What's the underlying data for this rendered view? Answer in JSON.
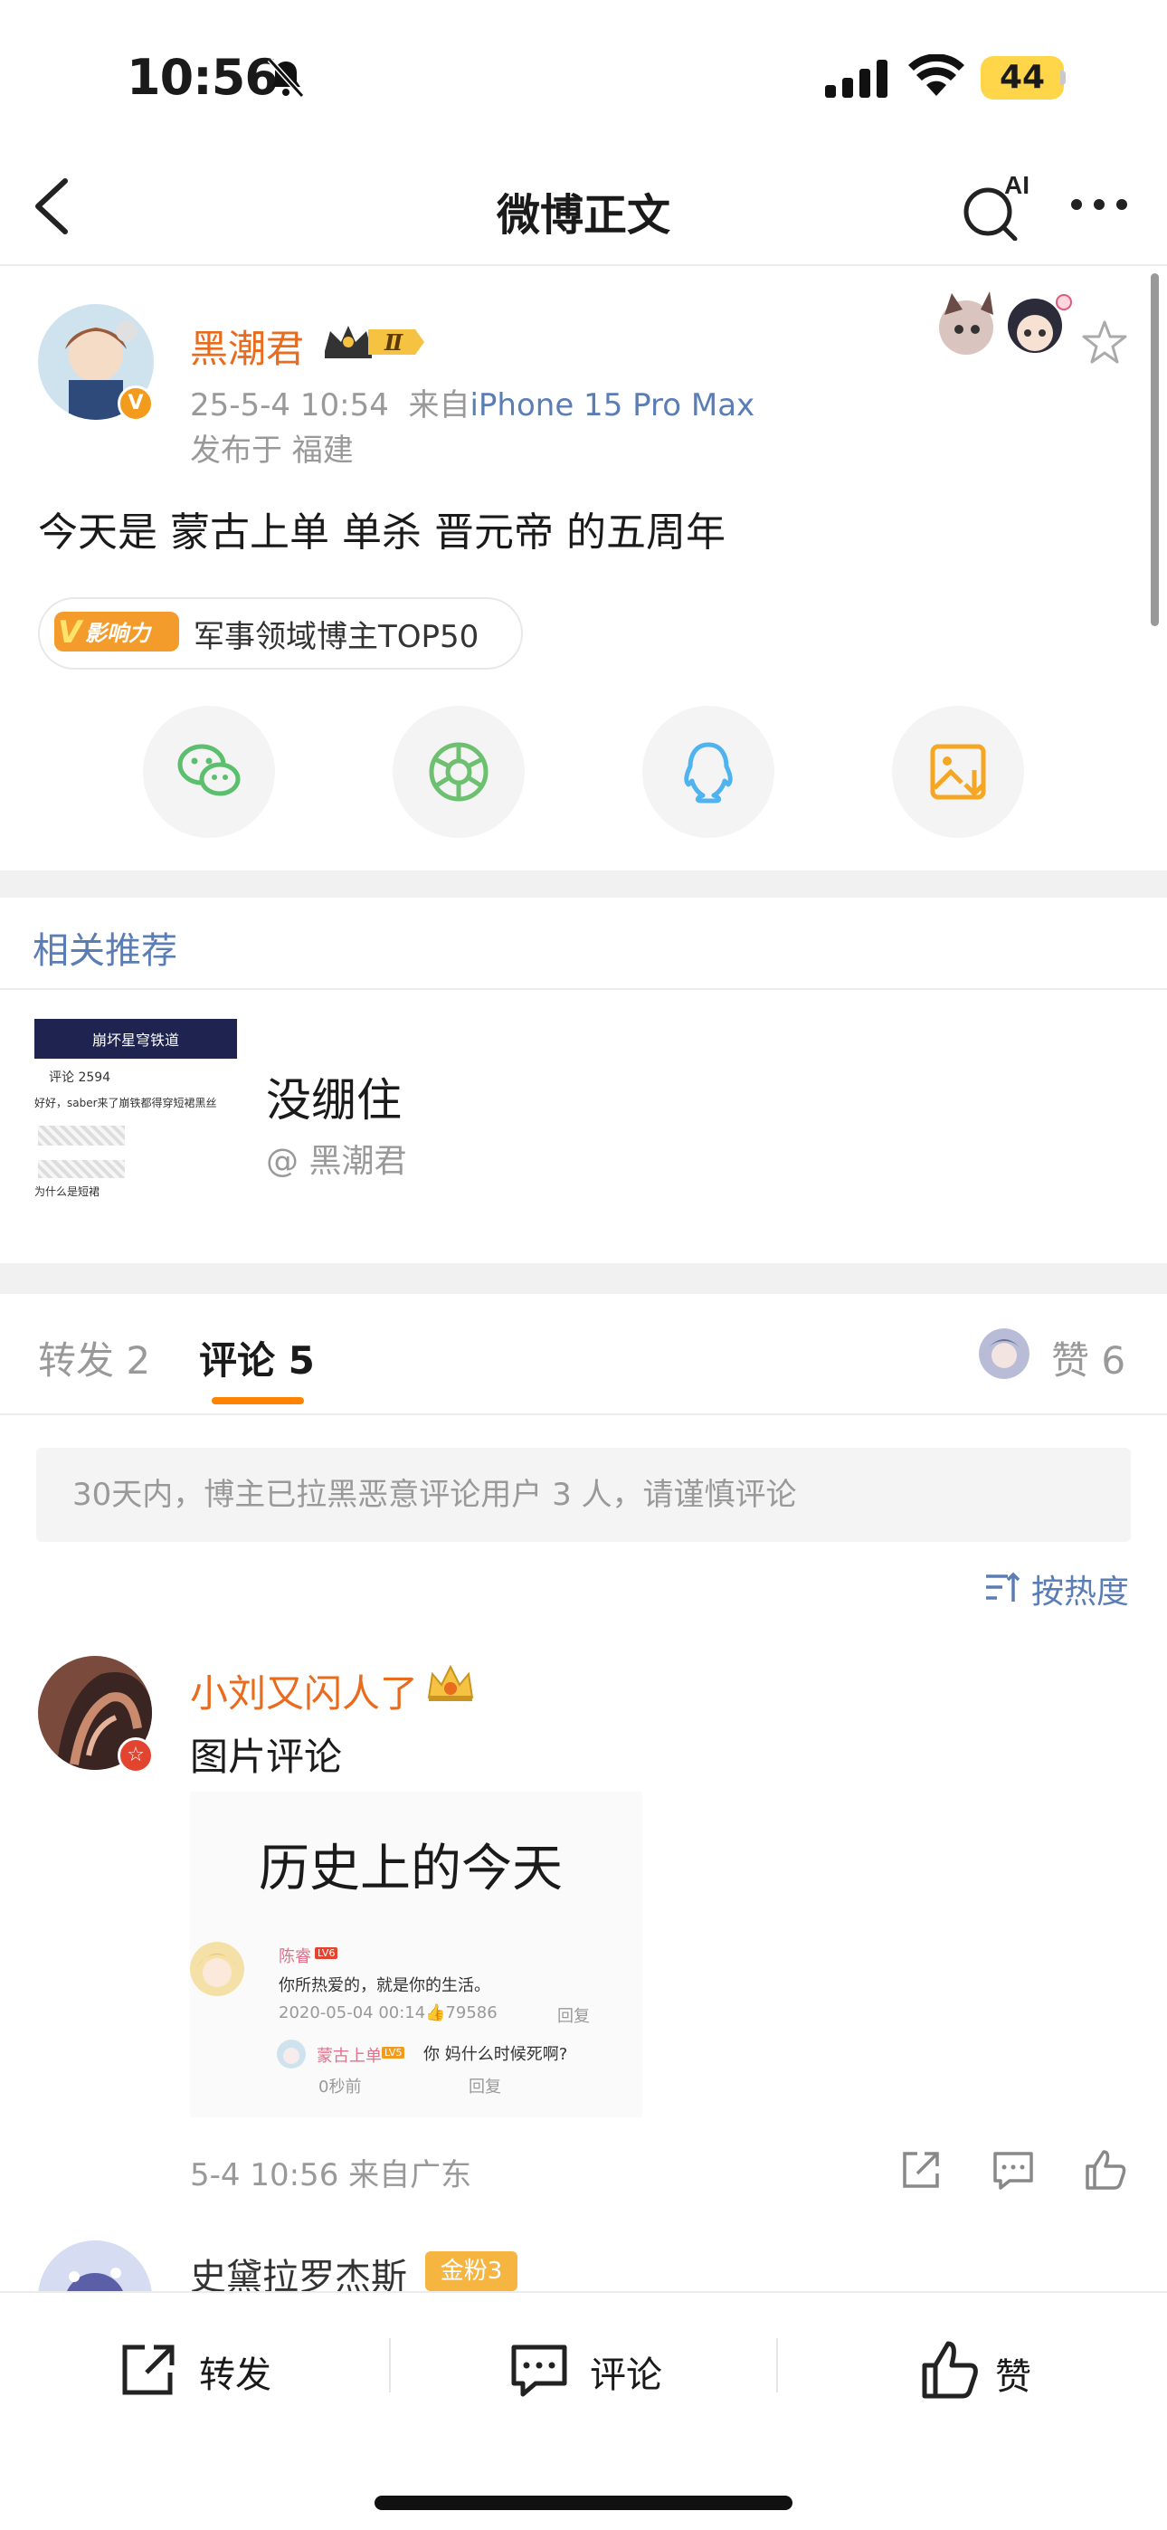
{
  "status_bar": {
    "time": "10:56",
    "battery": "44"
  },
  "nav": {
    "title": "微博正文",
    "ai_label": "AI"
  },
  "post": {
    "author": "黑潮君",
    "rank_badge": "Ⅱ",
    "verified_badge": "V",
    "date": "25-5-4 10:54",
    "source_prefix": "来自",
    "device": "iPhone 15 Pro Max",
    "location": "发布于 福建",
    "text": "今天是 蒙古上单 单杀 晋元帝 的五周年",
    "influence_tag": "V影响力",
    "influence_text": "军事领域博主TOP50"
  },
  "related": {
    "section_title": "相关推荐",
    "item_title": "没绷住",
    "item_author": "@ 黑潮君",
    "thumb": {
      "header": "崩坏星穹铁道",
      "comments": "评论 2594",
      "line1": "好好，saber来了崩铁都得穿短裙黑丝",
      "line2": "为什么是短裙"
    }
  },
  "tabs": {
    "repost": "转发 2",
    "comments": "评论 5",
    "likes": "赞 6"
  },
  "notice": "30天内，博主已拉黑恶意评论用户 3 人，请谨慎评论",
  "sort_label": "按热度",
  "comment": {
    "author": "小刘又闪人了",
    "text": "图片评论",
    "image": {
      "headline": "历史上的今天",
      "user1": "陈睿",
      "user1_level": "LV6",
      "quote": "你所热爱的，就是你的生活。",
      "date": "2020-05-04 00:14",
      "likes": "79586",
      "reply": "回复",
      "user2": "蒙古上单",
      "user2_level": "LV5",
      "reply_text": "你 妈什么时候死啊?",
      "reply_time": "0秒前",
      "reply2": "回复"
    },
    "meta": "5-4 10:56  来自广东"
  },
  "comment2": {
    "author": "史黛拉罗杰斯",
    "badge": "金粉3"
  },
  "bottom_bar": {
    "repost": "转发",
    "comment": "评论",
    "like": "赞"
  },
  "colors": {
    "accent_orange": "#ff8200",
    "link_blue": "#5a7db5",
    "name_orange": "#e86b1e"
  },
  "icons": [
    "chevron-left-icon",
    "ai-search-icon",
    "more-icon",
    "star-icon",
    "wechat-icon",
    "moments-icon",
    "qq-icon",
    "save-image-icon",
    "sort-icon",
    "share-icon",
    "comment-icon",
    "like-icon"
  ]
}
